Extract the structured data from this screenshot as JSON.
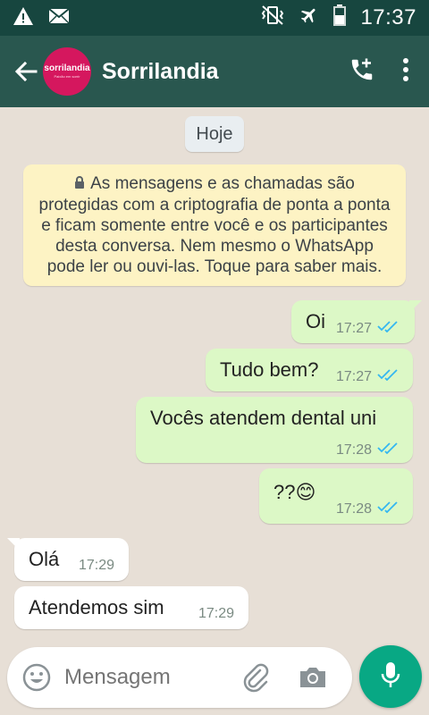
{
  "status_bar": {
    "time": "17:37",
    "icons": [
      "warning-icon",
      "mail-icon",
      "vibrate-icon",
      "airplane-mode-icon",
      "battery-icon"
    ]
  },
  "app_bar": {
    "contact_name": "Sorrilandia",
    "avatar_logo": "sorrilandia",
    "avatar_tagline": "Paixão em sorrir",
    "icons": [
      "back-arrow-icon",
      "add-call-icon",
      "more-vert-icon"
    ]
  },
  "chat": {
    "date_chip": "Hoje",
    "encryption_notice": "As mensagens e as chamadas são protegidas com a criptografia de ponta a ponta e ficam somente entre você e os participantes desta conversa. Nem mesmo o WhatsApp pode ler ou ouvi-las. Toque para saber mais.",
    "messages": [
      {
        "direction": "out",
        "text": "Oi",
        "time": "17:27",
        "status": "read"
      },
      {
        "direction": "out",
        "text": "Tudo bem?",
        "time": "17:27",
        "status": "read"
      },
      {
        "direction": "out",
        "text": "Vocês atendem dental uni",
        "time": "17:28",
        "status": "read"
      },
      {
        "direction": "out",
        "text": "??😊",
        "time": "17:28",
        "status": "read"
      },
      {
        "direction": "in",
        "text": "Olá",
        "time": "17:29"
      },
      {
        "direction": "in",
        "text": "Atendemos sim",
        "time": "17:29"
      }
    ]
  },
  "input_bar": {
    "placeholder": "Mensagem",
    "icons": [
      "emoji-icon",
      "attach-icon",
      "camera-icon",
      "mic-icon"
    ]
  },
  "colors": {
    "app_bar": "#29574f",
    "status_bar": "#17463f",
    "outgoing_bubble": "#dcf8c6",
    "incoming_bubble": "#ffffff",
    "read_ticks": "#34b7f1",
    "mic_button": "#08a884",
    "notice_bg": "#fdf3c4"
  }
}
